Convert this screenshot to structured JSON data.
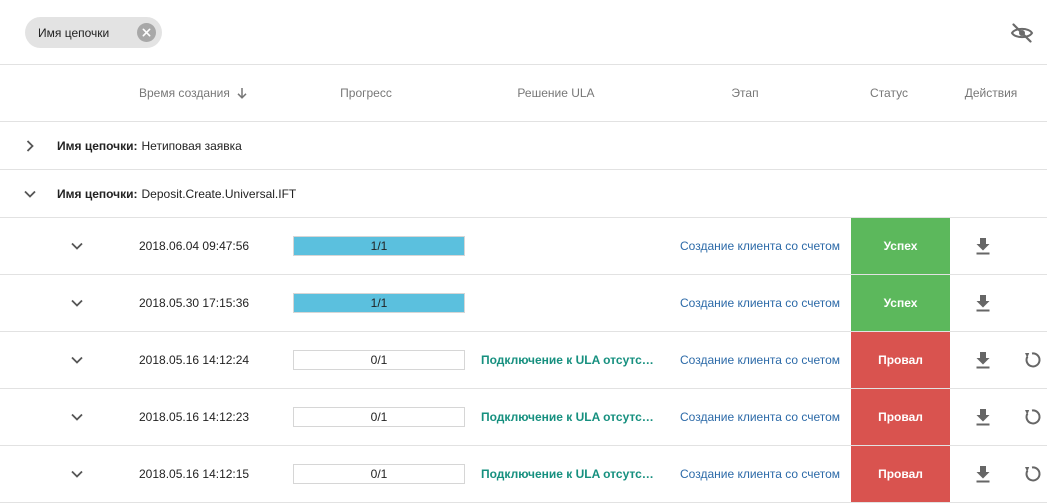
{
  "filter_chip": {
    "label": "Имя цепочки",
    "icon": "close-icon"
  },
  "visibility_toggle": {
    "icon": "eye-off-icon"
  },
  "columns": {
    "created_time": "Время создания",
    "progress": "Прогресс",
    "ula_decision": "Решение ULA",
    "stage": "Этап",
    "status": "Статус",
    "actions": "Действия"
  },
  "sort": {
    "column": "created_time",
    "direction": "descending",
    "icon": "arrow-down-icon"
  },
  "colors": {
    "success": "#5cb85c",
    "fail": "#d9534f",
    "progress_fill": "#5bc0de",
    "link": "#2c6aa8",
    "ula_text": "#16907f"
  },
  "groups": [
    {
      "label": "Имя цепочки:",
      "value": "Нетиповая заявка",
      "expanded": false,
      "icon": "chevron-right-icon"
    },
    {
      "label": "Имя цепочки:",
      "value": "Deposit.Create.Universal.IFT",
      "expanded": true,
      "icon": "chevron-down-icon"
    }
  ],
  "rows": [
    {
      "time": "2018.06.04 09:47:56",
      "progress_text": "1/1",
      "progress_fraction": 1,
      "ula": "",
      "stage": "Создание клиента со счетом",
      "status": "Успех",
      "status_type": "success",
      "actions": [
        "download-icon"
      ]
    },
    {
      "time": "2018.05.30 17:15:36",
      "progress_text": "1/1",
      "progress_fraction": 1,
      "ula": "",
      "stage": "Создание клиента со счетом",
      "status": "Успех",
      "status_type": "success",
      "actions": [
        "download-icon"
      ]
    },
    {
      "time": "2018.05.16 14:12:24",
      "progress_text": "0/1",
      "progress_fraction": 0,
      "ula": "Подключение к ULA отсутствует",
      "stage": "Создание клиента со счетом",
      "status": "Провал",
      "status_type": "fail",
      "actions": [
        "download-icon",
        "retry-icon"
      ]
    },
    {
      "time": "2018.05.16 14:12:23",
      "progress_text": "0/1",
      "progress_fraction": 0,
      "ula": "Подключение к ULA отсутствует",
      "stage": "Создание клиента со счетом",
      "status": "Провал",
      "status_type": "fail",
      "actions": [
        "download-icon",
        "retry-icon"
      ]
    },
    {
      "time": "2018.05.16 14:12:15",
      "progress_text": "0/1",
      "progress_fraction": 0,
      "ula": "Подключение к ULA отсутствует",
      "stage": "Создание клиента со счетом",
      "status": "Провал",
      "status_type": "fail",
      "actions": [
        "download-icon",
        "retry-icon"
      ]
    }
  ]
}
